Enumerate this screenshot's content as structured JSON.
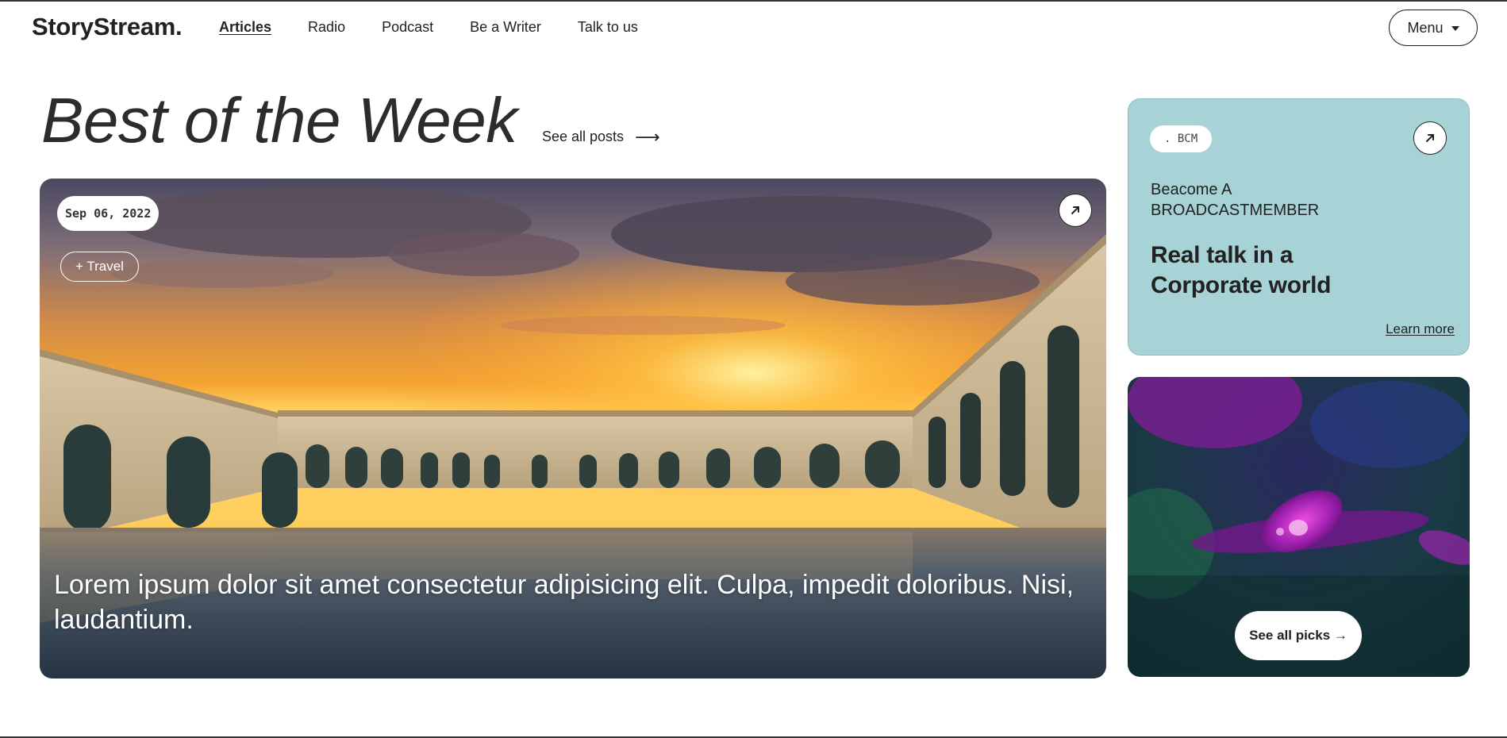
{
  "header": {
    "logo": "StoryStream.",
    "nav": [
      {
        "label": "Articles",
        "active": true
      },
      {
        "label": "Radio"
      },
      {
        "label": "Podcast"
      },
      {
        "label": "Be a Writer"
      },
      {
        "label": "Talk to us"
      }
    ],
    "menu_label": "Menu"
  },
  "section": {
    "title": "Best of the Week",
    "see_all_label": "See all posts",
    "see_all_arrow": "⟶"
  },
  "hero": {
    "date": "Sep 06, 2022",
    "tag": "+ Travel",
    "headline": "Lorem ipsum dolor sit amet consectetur adipisicing elit. Culpa, impedit doloribus. Nisi, laudantium.",
    "open_icon": "arrow-up-right-icon",
    "image": "mosque-courtyard-sunset-reflection"
  },
  "promo": {
    "chip": ". BCM",
    "subtitle_line1": "Beacome A",
    "subtitle_line2": "BROADCASTMEMBER",
    "headline_line1": "Real talk in a",
    "headline_line2": "Corporate world",
    "link_label": "Learn more",
    "bg_color": "#a7d3d6",
    "open_icon": "arrow-up-right-icon"
  },
  "picks": {
    "button_label": "See all picks →",
    "image": "purple-flower-petal-waterdrop"
  },
  "colors": {
    "text": "#222222",
    "promo_bg": "#a7d3d6",
    "white": "#ffffff"
  }
}
